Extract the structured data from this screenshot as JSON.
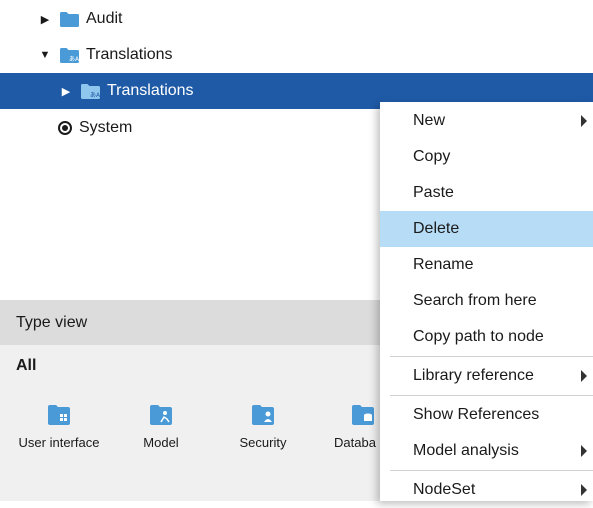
{
  "tree": {
    "items": [
      {
        "label": "Audit",
        "icon": "folder-icon",
        "expanded": false
      },
      {
        "label": "Translations",
        "icon": "translations-folder-icon",
        "expanded": true
      },
      {
        "label": "Translations",
        "icon": "translations-folder-icon",
        "expanded": false,
        "selected": true
      },
      {
        "label": "System",
        "icon": "system-icon"
      }
    ]
  },
  "typeview": {
    "title": "Type view",
    "filter": "All",
    "items": [
      {
        "label": "User interface",
        "icon": "user-interface-folder-icon"
      },
      {
        "label": "Model",
        "icon": "model-folder-icon"
      },
      {
        "label": "Security",
        "icon": "security-folder-icon"
      },
      {
        "label": "Databa",
        "icon": "database-folder-icon"
      }
    ]
  },
  "context_menu": {
    "items": [
      {
        "label": "New",
        "submenu": true
      },
      {
        "label": "Copy"
      },
      {
        "label": "Paste"
      },
      {
        "label": "Delete",
        "highlighted": true
      },
      {
        "label": "Rename"
      },
      {
        "label": "Search from here"
      },
      {
        "label": "Copy path to node"
      },
      {
        "label": "Library reference",
        "submenu": true
      },
      {
        "label": "Show References"
      },
      {
        "label": "Model analysis",
        "submenu": true
      },
      {
        "label": "NodeSet",
        "submenu": true
      }
    ]
  },
  "colors": {
    "selection": "#1f5aa6",
    "folder": "#4a9ad8",
    "menu_highlight": "#b7dcf5",
    "panel_header": "#dcdcdc"
  }
}
